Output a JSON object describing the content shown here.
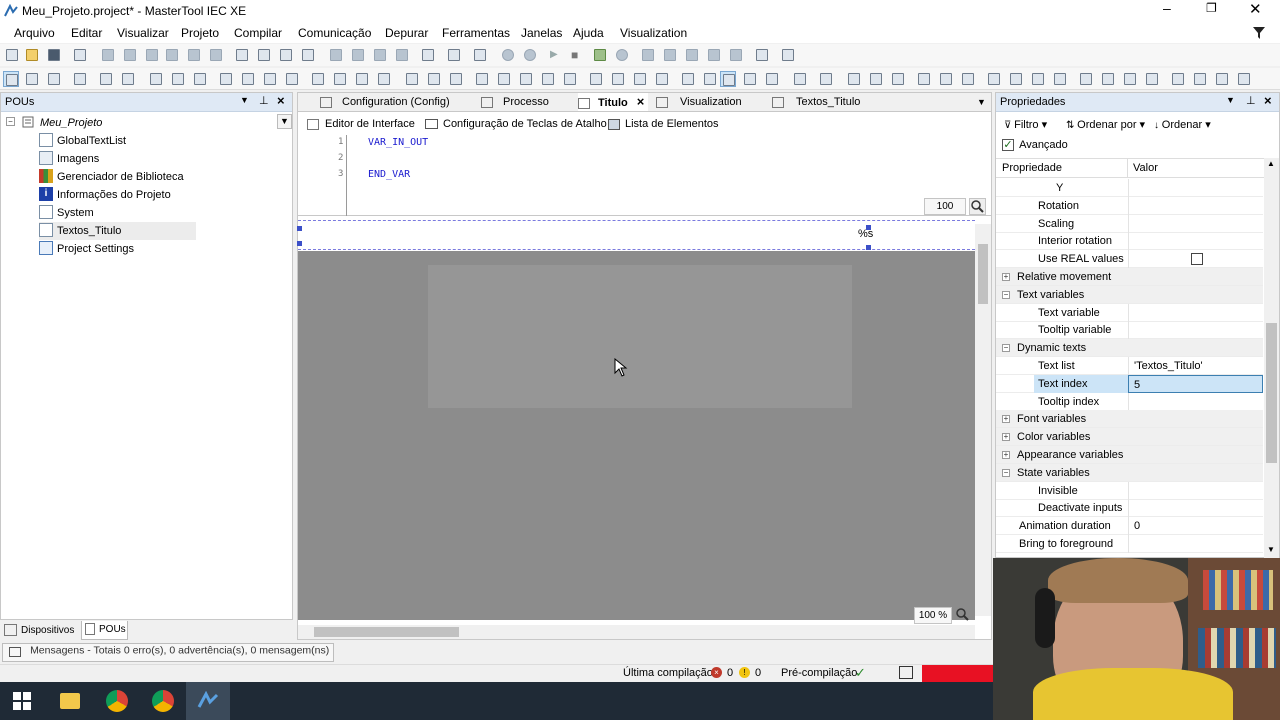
{
  "window": {
    "title": "Meu_Projeto.project* - MasterTool IEC XE"
  },
  "menu": [
    "Arquivo",
    "Editar",
    "Visualizar",
    "Projeto",
    "Compilar",
    "Comunicação",
    "Depurar",
    "Ferramentas",
    "Janelas",
    "Ajuda",
    "Visualization"
  ],
  "pous": {
    "title": "POUs",
    "tree": [
      "Meu_Projeto",
      "GlobalTextList",
      "Imagens",
      "Gerenciador de Biblioteca",
      "Informações do Projeto",
      "System",
      "Textos_Titulo",
      "Project Settings"
    ],
    "bottom_tabs": [
      "Dispositivos",
      "POUs"
    ]
  },
  "editor": {
    "tabs": [
      "Configuration (Config)",
      "Processo",
      "Titulo",
      "Visualization",
      "Textos_Titulo"
    ],
    "subtabs": [
      "Editor de Interface",
      "Configuração de Teclas de Atalho",
      "Lista de Elementos"
    ],
    "code": [
      "1",
      "2",
      "3"
    ],
    "code_text": [
      "VAR_IN_OUT",
      "",
      "END_VAR"
    ],
    "code_zoom": "100",
    "canvas_label": "%s",
    "canvas_zoom": "100 %"
  },
  "props": {
    "title": "Propriedades",
    "toolbar": [
      "Filtro",
      "Ordenar por",
      "Ordenar"
    ],
    "advanced": "Avançado",
    "headers": [
      "Propriedade",
      "Valor"
    ],
    "rows": [
      {
        "name": "Y",
        "group": false,
        "value": ""
      },
      {
        "name": "Rotation",
        "group": false,
        "value": ""
      },
      {
        "name": "Scaling",
        "group": false,
        "value": ""
      },
      {
        "name": "Interior rotation",
        "group": false,
        "value": ""
      },
      {
        "name": "Use REAL values",
        "group": false,
        "value": ""
      },
      {
        "name": "Relative movement",
        "group": true,
        "sign": "+",
        "value": ""
      },
      {
        "name": "Text variables",
        "group": true,
        "sign": "−",
        "value": ""
      },
      {
        "name": "Text variable",
        "group": false,
        "value": ""
      },
      {
        "name": "Tooltip variable",
        "group": false,
        "value": ""
      },
      {
        "name": "Dynamic texts",
        "group": true,
        "sign": "−",
        "value": ""
      },
      {
        "name": "Text list",
        "group": false,
        "value": "'Textos_Titulo'"
      },
      {
        "name": "Text index",
        "group": false,
        "value": "5"
      },
      {
        "name": "Tooltip index",
        "group": false,
        "value": ""
      },
      {
        "name": "Font variables",
        "group": true,
        "sign": "+",
        "value": ""
      },
      {
        "name": "Color variables",
        "group": true,
        "sign": "+",
        "value": ""
      },
      {
        "name": "Appearance variables",
        "group": true,
        "sign": "+",
        "value": ""
      },
      {
        "name": "State variables",
        "group": true,
        "sign": "−",
        "value": ""
      },
      {
        "name": "Invisible",
        "group": false,
        "value": ""
      },
      {
        "name": "Deactivate inputs",
        "group": false,
        "value": ""
      },
      {
        "name": "Animation duration",
        "group": false,
        "value": "0"
      },
      {
        "name": "Bring to foreground",
        "group": false,
        "value": ""
      }
    ]
  },
  "messages": {
    "label": "Mensagens - Totais 0 erro(s), 0 advertência(s), 0 mensagem(ns)"
  },
  "status": {
    "last_compile": "Última compilação:",
    "errors": "0",
    "warnings": "0",
    "precompile": "Pré-compilação"
  },
  "colors": {
    "accent": "#3c7fb1",
    "panel_header": "#dfe9f5",
    "selection": "#cce4f7",
    "overlay": "#8c8c8c",
    "red": "#e81123"
  }
}
